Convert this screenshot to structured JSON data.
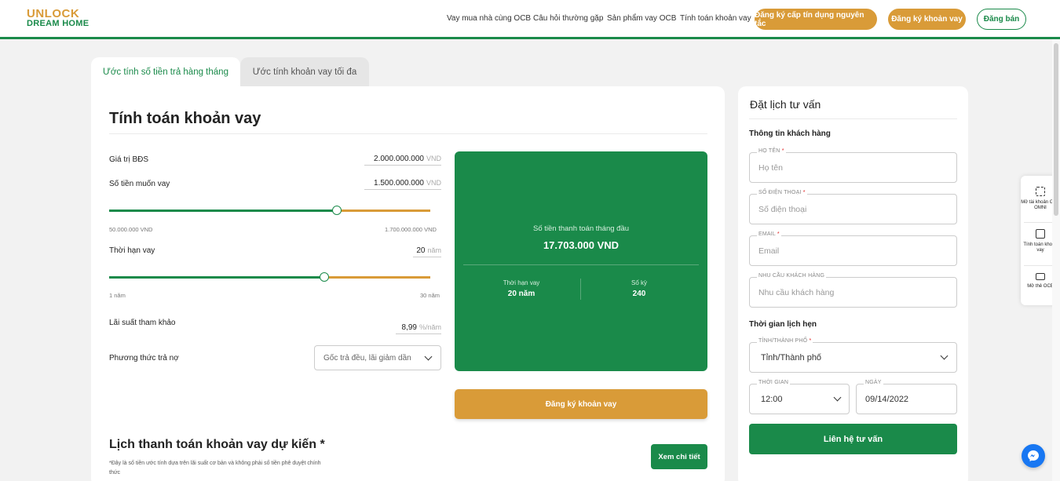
{
  "header": {
    "logo_top": "UNLOCK",
    "logo_bottom": "DREAM HOME",
    "nav": [
      "Vay mua nhà cùng OCB",
      "Câu hỏi thường gặp",
      "Sản phẩm vay OCB",
      "Tính toán khoản vay"
    ],
    "btn_credit": "Đăng ký cấp tín dụng nguyên tắc",
    "btn_register": "Đăng ký khoản vay",
    "btn_sell": "Đăng bán"
  },
  "tabs": [
    "Ước tính số tiền trả hàng tháng",
    "Ước tính khoản vay tối đa"
  ],
  "calculator": {
    "title": "Tính toán khoản vay",
    "property_label": "Giá trị BĐS",
    "property_value": "2.000.000.000",
    "loan_label": "Số tiền muốn vay",
    "loan_value": "1.500.000.000",
    "currency": "VND",
    "loan_min": "50.000.000",
    "loan_max": "1.700.000.000",
    "loan_slider_fraction": 0.71,
    "term_label": "Thời hạn vay",
    "term_value": "20",
    "term_unit": "năm",
    "term_min": "1 năm",
    "term_max": "30 năm",
    "term_slider_fraction": 0.67,
    "rate_label": "Lãi suất tham khảo",
    "rate_value": "8,99",
    "rate_unit": "%/năm",
    "method_label": "Phương thức trả nợ",
    "method_value": "Gốc trả đều, lãi giảm dần"
  },
  "result": {
    "title": "Số tiền thanh toán tháng đầu",
    "value": "17.703.000 VND",
    "term_label": "Thời hạn vay",
    "term_value": "20 năm",
    "periods_label": "Số kỳ",
    "periods_value": "240",
    "cta": "Đăng ký khoản vay"
  },
  "schedule": {
    "title": "Lịch thanh toán khoản vay dự kiến *",
    "note": "*Đây là số tiền ước tính dựa trên lãi suất cơ bản và không phải số tiền phê duyệt chính thức",
    "detail_button": "Xem chi tiết"
  },
  "booking": {
    "title": "Đặt lịch tư vấn",
    "customer_section": "Thông tin khách hàng",
    "name_label": "HỌ TÊN",
    "name_placeholder": "Họ tên",
    "phone_label": "SỐ ĐIỆN THOẠI",
    "phone_placeholder": "Số điện thoại",
    "email_label": "EMAIL",
    "email_placeholder": "Email",
    "need_label": "NHU CẦU KHÁCH HÀNG",
    "need_placeholder": "Nhu cầu khách hàng",
    "time_section": "Thời gian lịch hẹn",
    "city_label": "TỈNH/THÀNH PHỐ",
    "city_value": "Tỉnh/Thành phố",
    "time_label": "THỜI GIAN",
    "time_value": "12:00",
    "date_label": "NGÀY",
    "date_value": "09/14/2022",
    "submit": "Liên hệ tư vấn"
  },
  "floating": {
    "open_account": "Mở tài khoản OCB OMNI",
    "calc_loan": "Tính toán khoản vay",
    "open_card": "Mở thẻ OCB"
  },
  "colors": {
    "brand_green": "#1a8a4a",
    "brand_gold": "#d99b38"
  }
}
